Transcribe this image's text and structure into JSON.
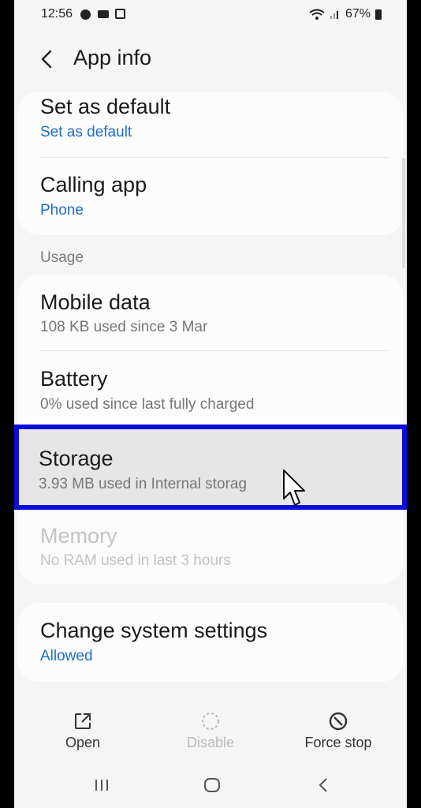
{
  "status_bar": {
    "time": "12:56",
    "battery": "67%"
  },
  "header": {
    "title": "App info"
  },
  "rows": {
    "set_default": {
      "title": "Set as default",
      "subtitle": "Set as default"
    },
    "calling_app": {
      "title": "Calling app",
      "subtitle": "Phone"
    },
    "usage_label": "Usage",
    "mobile_data": {
      "title": "Mobile data",
      "subtitle": "108 KB used since 3 Mar"
    },
    "battery": {
      "title": "Battery",
      "subtitle": "0% used since last fully charged"
    },
    "storage": {
      "title": "Storage",
      "subtitle": "3.93 MB used in Internal storag"
    },
    "memory": {
      "title": "Memory",
      "subtitle": "No RAM used in last 3 hours"
    },
    "system_settings": {
      "title": "Change system settings",
      "subtitle": "Allowed"
    }
  },
  "bottom_actions": {
    "open": "Open",
    "disable": "Disable",
    "force_stop": "Force stop"
  },
  "colors": {
    "accent": "#1f6fc5",
    "highlight_border": "#0b0bdb"
  }
}
